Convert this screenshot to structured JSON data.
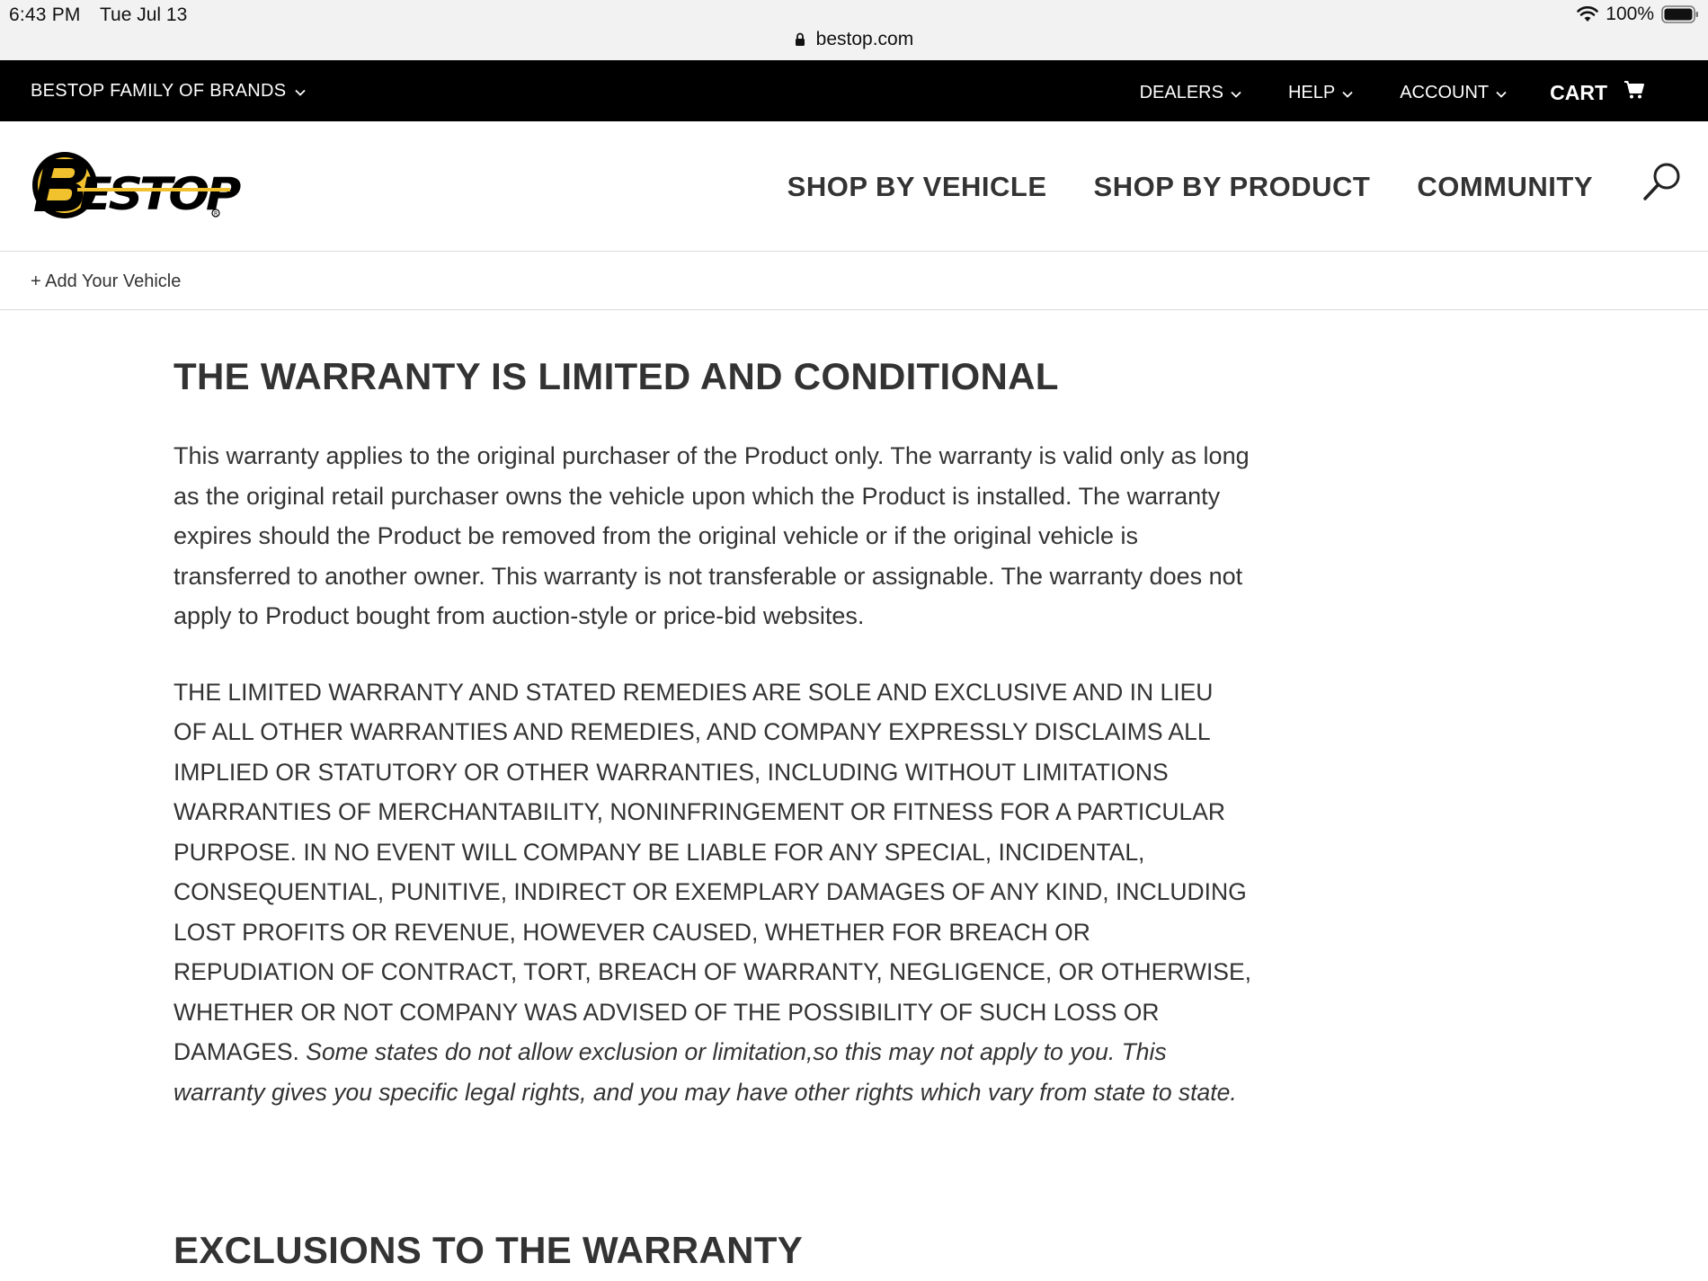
{
  "status": {
    "time": "6:43 PM",
    "date": "Tue Jul 13",
    "battery": "100%",
    "url": "bestop.com"
  },
  "topbar": {
    "family_label": "BESTOP FAMILY OF BRANDS",
    "dealers_label": "DEALERS",
    "help_label": "HELP",
    "account_label": "ACCOUNT",
    "cart_label": "CART"
  },
  "header": {
    "logo_text": "BESTOP",
    "nav": {
      "shop_by_vehicle": "SHOP BY VEHICLE",
      "shop_by_product": "SHOP BY PRODUCT",
      "community": "COMMUNITY"
    }
  },
  "vehicle": {
    "add_label": "+ Add Your Vehicle"
  },
  "content": {
    "title": "THE WARRANTY IS LIMITED AND CONDITIONAL",
    "paragraph1": "This warranty applies to the original purchaser of the Product only. The warranty is valid only as long as the original retail purchaser owns the vehicle upon which the Product is installed. The warranty expires should the Product be removed from the original vehicle or if the original vehicle is transferred to another owner. This warranty is not transferable or assignable. The warranty does not apply to Product bought from auction-style or price-bid websites.",
    "paragraph2_caps": "THE LIMITED WARRANTY AND STATED REMEDIES ARE SOLE AND EXCLUSIVE AND IN LIEU OF ALL OTHER WARRANTIES AND REMEDIES, AND COMPANY EXPRESSLY DISCLAIMS ALL IMPLIED OR STATUTORY OR OTHER WARRANTIES, INCLUDING WITHOUT LIMITATIONS WARRANTIES OF MERCHANTABILITY, NONINFRINGEMENT OR FITNESS FOR A PARTICULAR PURPOSE. IN NO EVENT WILL COMPANY BE LIABLE FOR ANY SPECIAL, INCIDENTAL, CONSEQUENTIAL, PUNITIVE, INDIRECT OR EXEMPLARY DAMAGES OF ANY KIND, INCLUDING LOST PROFITS OR REVENUE, HOWEVER CAUSED, WHETHER FOR BREACH OR REPUDIATION OF CONTRACT, TORT, BREACH OF WARRANTY, NEGLIGENCE, OR OTHERWISE, WHETHER OR NOT COMPANY WAS ADVISED OF THE POSSIBILITY OF SUCH LOSS OR DAMAGES.",
    "paragraph2_italic": "Some states do not allow exclusion or limitation,so this may not apply to you. This warranty gives you specific legal rights, and you may have other rights which vary from state to state.",
    "next_title": "EXCLUSIONS TO THE WARRANTY"
  },
  "colors": {
    "topbar_bg": "#000000",
    "logo_yellow": "#f2c12e",
    "text": "#333333"
  }
}
